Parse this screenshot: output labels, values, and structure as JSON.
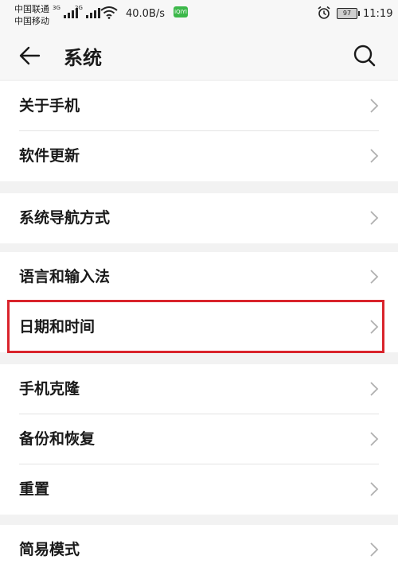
{
  "status_bar": {
    "carrier_1": "中国联通",
    "carrier_2": "中国移动",
    "signal_1_tag": "3G",
    "signal_2_tag": "2G",
    "net_speed": "40.0B/s",
    "app_badge": "iQIYI",
    "battery": "97",
    "time": "11:19"
  },
  "header": {
    "title": "系统",
    "back_icon": "arrow-left-icon",
    "search_icon": "search-icon"
  },
  "groups": [
    {
      "items": [
        {
          "label": "关于手机"
        },
        {
          "label": "软件更新"
        }
      ]
    },
    {
      "items": [
        {
          "label": "系统导航方式"
        }
      ]
    },
    {
      "items": [
        {
          "label": "语言和输入法"
        },
        {
          "label": "日期和时间",
          "highlighted": true
        }
      ]
    },
    {
      "items": [
        {
          "label": "手机克隆"
        },
        {
          "label": "备份和恢复"
        },
        {
          "label": "重置"
        }
      ]
    },
    {
      "items": [
        {
          "label": "简易模式"
        }
      ]
    }
  ],
  "colors": {
    "highlight_border": "#d9242c",
    "background": "#f2f2f2",
    "row_background": "#ffffff",
    "chevron": "#b0b0b0"
  }
}
